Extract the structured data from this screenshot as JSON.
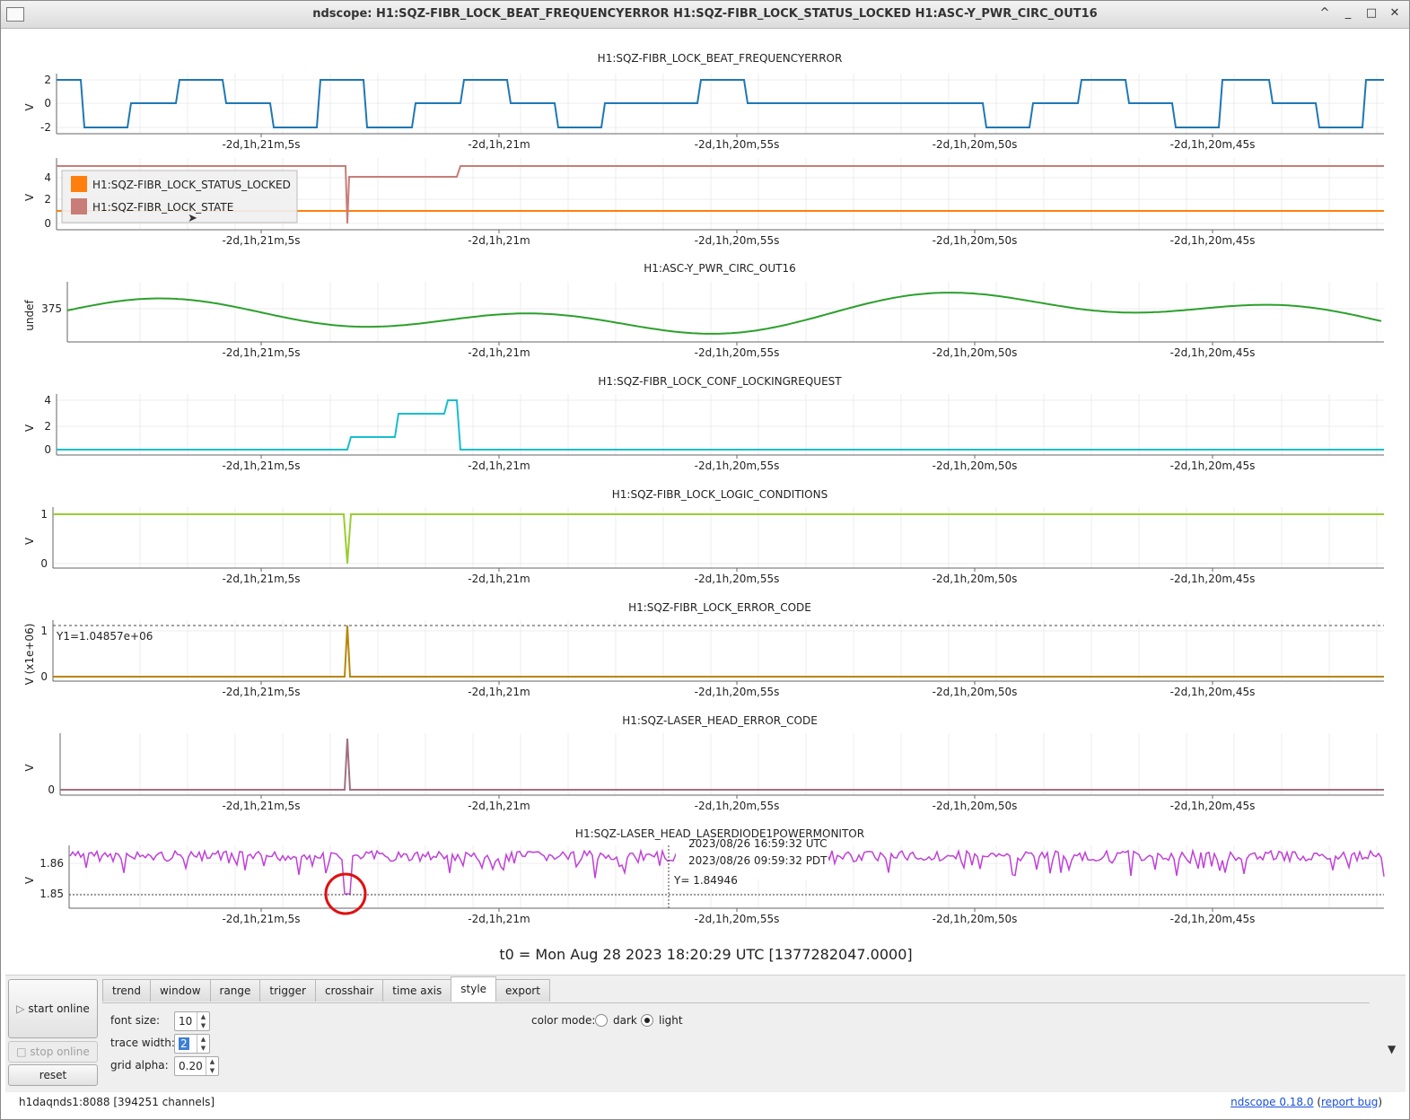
{
  "window": {
    "title": "ndscope: H1:SQZ-FIBR_LOCK_BEAT_FREQUENCYERROR H1:SQZ-FIBR_LOCK_STATUS_LOCKED H1:ASC-Y_PWR_CIRC_OUT16",
    "buttons": [
      "^",
      "_",
      "□",
      "✕"
    ]
  },
  "x_tick_labels": [
    "-2d,1h,21m,5s",
    "-2d,1h,21m",
    "-2d,1h,20m,55s",
    "-2d,1h,20m,50s",
    "-2d,1h,20m,45s"
  ],
  "plots": [
    {
      "id": "p1",
      "title": "H1:SQZ-FIBR_LOCK_BEAT_FREQUENCYERROR",
      "ylabel": "V",
      "yticks": [
        "2",
        "0",
        "-2"
      ],
      "color": "#1f77b4",
      "shape": "square"
    },
    {
      "id": "p2",
      "title": "",
      "ylabel": "V",
      "yticks": [
        "4",
        "2",
        "0"
      ],
      "legend": [
        {
          "name": "H1:SQZ-FIBR_LOCK_STATUS_LOCKED",
          "color": "#ff7f0e"
        },
        {
          "name": "H1:SQZ-FIBR_LOCK_STATE",
          "color": "#c87d78"
        }
      ],
      "shape": "state"
    },
    {
      "id": "p3",
      "title": "H1:ASC-Y_PWR_CIRC_OUT16",
      "ylabel": "undef",
      "yticks": [
        "375"
      ],
      "color": "#2ca02c",
      "shape": "smooth"
    },
    {
      "id": "p4",
      "title": "H1:SQZ-FIBR_LOCK_CONF_LOCKINGREQUEST",
      "ylabel": "V",
      "yticks": [
        "4",
        "2",
        "0"
      ],
      "color": "#17becf",
      "shape": "steps"
    },
    {
      "id": "p5",
      "title": "H1:SQZ-FIBR_LOCK_LOGIC_CONDITIONS",
      "ylabel": "V",
      "yticks": [
        "1",
        "0"
      ],
      "color": "#9acd32",
      "shape": "dip"
    },
    {
      "id": "p6",
      "title": "H1:SQZ-FIBR_LOCK_ERROR_CODE",
      "ylabel": "V (x1e+06)",
      "yticks": [
        "1",
        "0"
      ],
      "color": "#b8860b",
      "shape": "spike",
      "y1_label": "Y1=1.04857e+06"
    },
    {
      "id": "p7",
      "title": "H1:SQZ-LASER_HEAD_ERROR_CODE",
      "ylabel": "V",
      "yticks": [
        "0"
      ],
      "color": "#a07080",
      "shape": "spike"
    },
    {
      "id": "p8",
      "title": "H1:SQZ-LASER_HEAD_LASERDIODE1POWERMONITOR",
      "ylabel": "V",
      "yticks": [
        "1.86",
        "1.85"
      ],
      "color": "#c040d8",
      "shape": "noise",
      "crosshair": {
        "utc": "2023/08/26 16:59:32 UTC",
        "pdt": "2023/08/26 09:59:32 PDT",
        "y": "Y= 1.84946"
      }
    }
  ],
  "t0_label": "t0 = Mon Aug 28 2023 18:20:29 UTC [1377282047.0000]",
  "controls": {
    "start_online": "start online",
    "stop_online": "stop online",
    "reset": "reset",
    "tabs": [
      "trend",
      "window",
      "range",
      "trigger",
      "crosshair",
      "time axis",
      "style",
      "export"
    ],
    "active_tab": "style",
    "font_size_label": "font size:",
    "font_size_value": "10",
    "trace_width_label": "trace width:",
    "trace_width_value": "2",
    "grid_alpha_label": "grid alpha:",
    "grid_alpha_value": "0.20",
    "color_mode_label": "color mode:",
    "color_mode_options": [
      "dark",
      "light"
    ],
    "color_mode_selected": "light"
  },
  "status": {
    "server": "h1daqnds1:8088  [394251 channels]",
    "version_link": "ndscope 0.18.0",
    "bug_link": "report bug"
  }
}
